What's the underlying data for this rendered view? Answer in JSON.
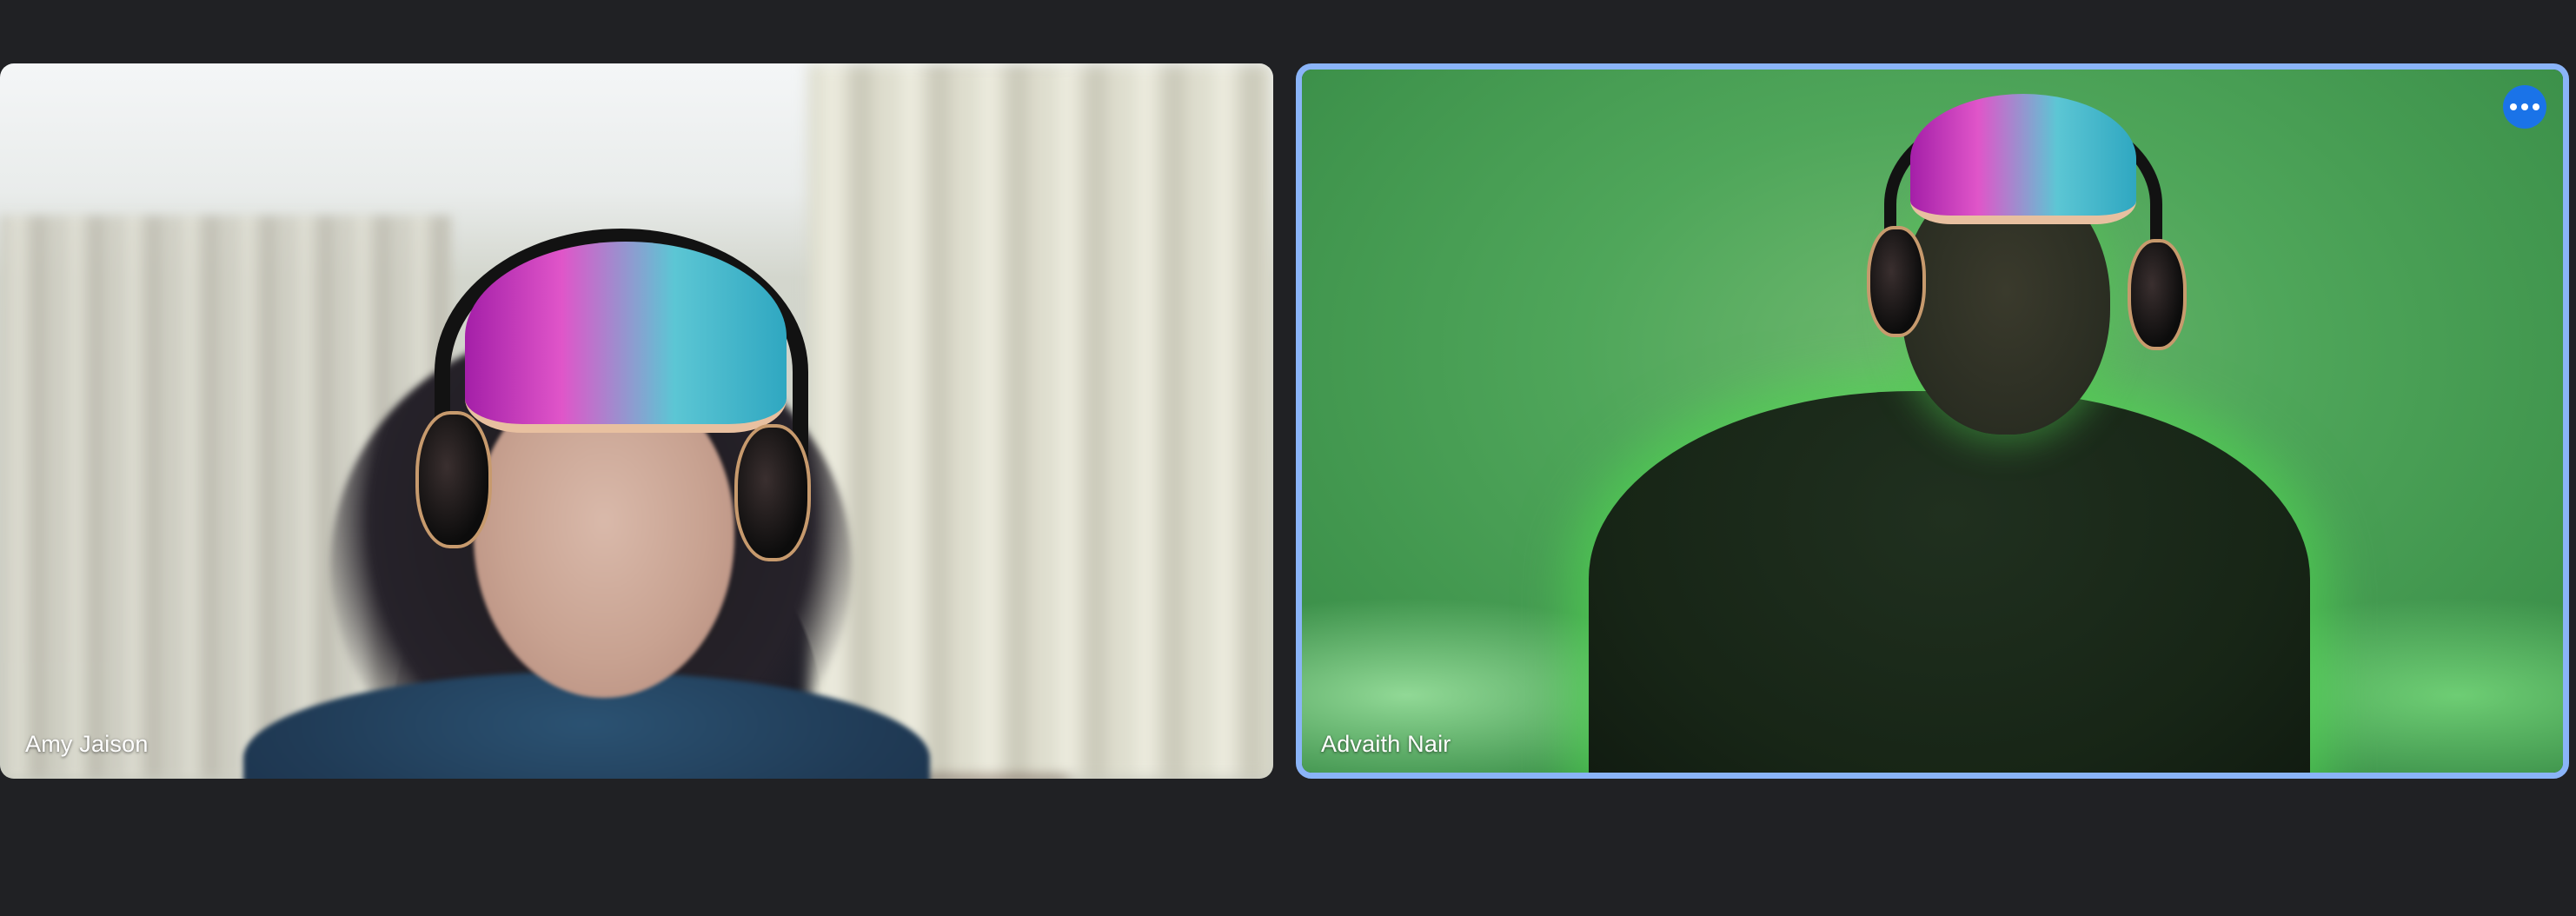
{
  "participants": [
    {
      "name": "Amy Jaison",
      "active_speaker": false
    },
    {
      "name": "Advaith Nair",
      "active_speaker": true
    }
  ],
  "colors": {
    "background": "#202124",
    "active_border": "#8ab4f8",
    "more_button": "#1a73e8"
  },
  "icons": {
    "more_options": "more-horizontal-icon"
  }
}
